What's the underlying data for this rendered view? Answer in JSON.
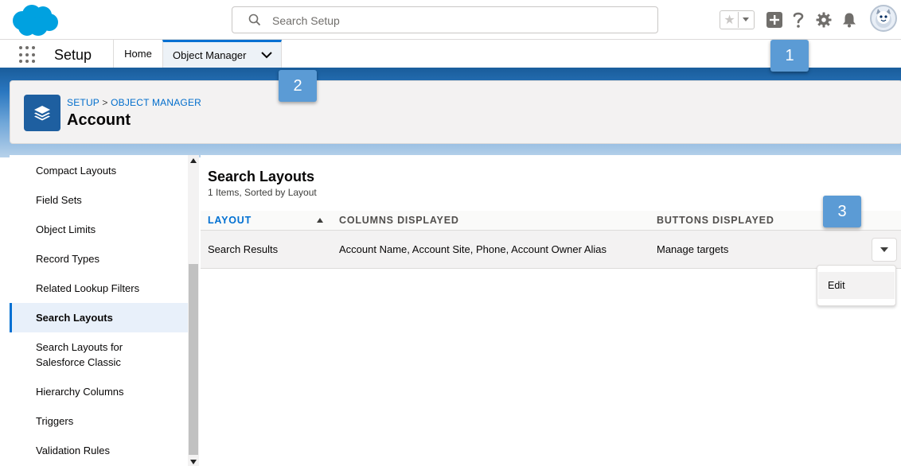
{
  "header": {
    "search_placeholder": "Search Setup"
  },
  "context_bar": {
    "app_name": "Setup",
    "tabs": [
      {
        "label": "Home"
      },
      {
        "label": "Object Manager"
      }
    ]
  },
  "page_header": {
    "breadcrumb": {
      "setup": "SETUP",
      "separator": ">",
      "object_manager": "OBJECT MANAGER"
    },
    "title": "Account"
  },
  "sidebar": {
    "items": [
      {
        "label": "Compact Layouts"
      },
      {
        "label": "Field Sets"
      },
      {
        "label": "Object Limits"
      },
      {
        "label": "Record Types"
      },
      {
        "label": "Related Lookup Filters"
      },
      {
        "label": "Search Layouts"
      },
      {
        "label": "Search Layouts for\nSalesforce Classic"
      },
      {
        "label": "Hierarchy Columns"
      },
      {
        "label": "Triggers"
      },
      {
        "label": "Validation Rules"
      }
    ],
    "active_item": "Search Layouts"
  },
  "main": {
    "title": "Search Layouts",
    "subtitle": "1 Items, Sorted by Layout",
    "columns": [
      "LAYOUT",
      "COLUMNS DISPLAYED",
      "BUTTONS DISPLAYED"
    ],
    "rows": [
      {
        "layout": "Search Results",
        "columns_displayed": "Account Name, Account Site, Phone, Account Owner Alias",
        "buttons_displayed": "Manage targets"
      }
    ],
    "row_menu": {
      "items": [
        {
          "label": "Edit"
        }
      ]
    }
  },
  "callouts": [
    {
      "number": "1"
    },
    {
      "number": "2"
    },
    {
      "number": "3"
    }
  ],
  "colors": {
    "brand_blue": "#0070d2",
    "callout_blue": "#5b9bd5",
    "object_icon": "#1e5fa0"
  }
}
